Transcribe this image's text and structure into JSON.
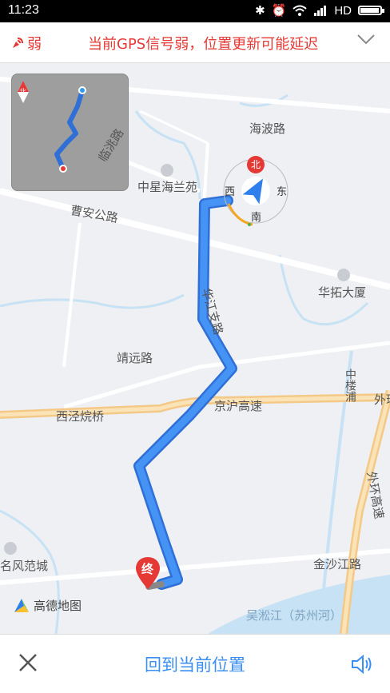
{
  "status_bar": {
    "time": "11:23",
    "network": "HD"
  },
  "gps_banner": {
    "signal_label": "弱",
    "message": "当前GPS信号弱，位置更新可能延迟"
  },
  "map": {
    "labels": {
      "haibo": "海波路",
      "linxi": "临洮路",
      "zhongxing": "中星海兰苑",
      "caoan": "曹安公路",
      "huaxia": "华拓大厦",
      "huajiang": "华江支路",
      "jingyuan": "靖远路",
      "xijing": "西泾烷桥",
      "jinghu": "京沪高速",
      "zhonglou": "中楼浦",
      "waihuan": "外环高速",
      "mingfeng": "名风范城",
      "jinsha": "金沙江路",
      "wusong": "吴淞江（苏州河）",
      "wai_edge": "外环"
    },
    "compass": {
      "north": "北",
      "south": "南",
      "east": "东",
      "west": "西"
    },
    "end_marker": "终",
    "minimap_north": "北",
    "logo_text": "高德地图"
  },
  "bottom_bar": {
    "center_label": "回到当前位置"
  }
}
